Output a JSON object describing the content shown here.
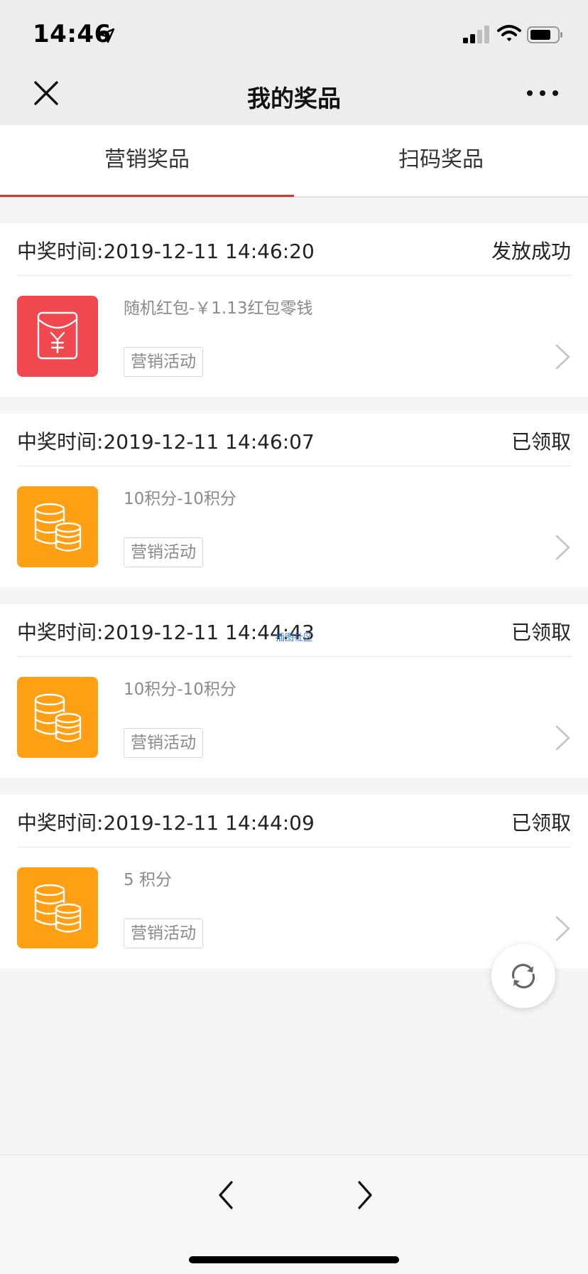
{
  "status_bar": {
    "time": "14:46",
    "location_icon": "location-arrow-icon",
    "signal_icon": "cellular-signal-icon",
    "wifi_icon": "wifi-icon",
    "battery_icon": "battery-icon"
  },
  "nav": {
    "title": "我的奖品",
    "close_icon": "close-icon",
    "more_icon": "more-dots-icon"
  },
  "tabs": [
    {
      "label": "营销奖品",
      "active": true
    },
    {
      "label": "扫码奖品",
      "active": false
    }
  ],
  "colors": {
    "accent": "#d4362c",
    "red_envelope_bg": "#f0484e",
    "points_bg": "#ff9f14"
  },
  "prizes": [
    {
      "time_label": "中奖时间:",
      "time": "2019-12-11 14:46:20",
      "status": "发放成功",
      "name": "随机红包-￥1.13红包零钱",
      "tag": "营销活动",
      "icon": "red-envelope-icon"
    },
    {
      "time_label": "中奖时间:",
      "time": "2019-12-11 14:46:07",
      "status": "已领取",
      "name": "10积分-10积分",
      "tag": "营销活动",
      "icon": "coins-icon"
    },
    {
      "time_label": "中奖时间:",
      "time": "2019-12-11 14:44:43",
      "status": "已领取",
      "name": "10积分-10积分",
      "tag": "营销活动",
      "icon": "coins-icon"
    },
    {
      "time_label": "中奖时间:",
      "time": "2019-12-11 14:44:09",
      "status": "已领取",
      "name": "5 积分",
      "tag": "营销活动",
      "icon": "coins-icon"
    }
  ],
  "watermark": "插图社区",
  "refresh_icon": "refresh-icon",
  "bottom_bar": {
    "back_icon": "chevron-left-icon",
    "forward_icon": "chevron-right-icon"
  }
}
